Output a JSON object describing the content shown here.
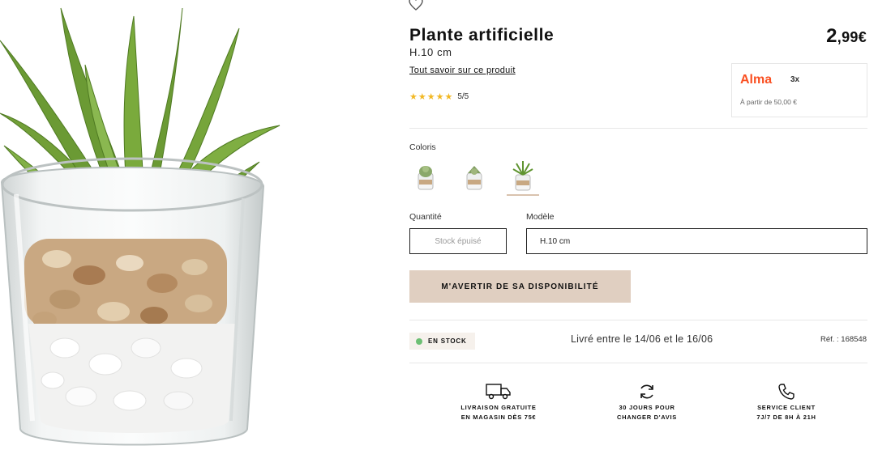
{
  "product": {
    "title": "Plante artificielle",
    "subtitle": "H.10 cm",
    "about_link": "Tout savoir sur ce produit",
    "rating_stars": "★★★★★",
    "rating_text": "5/5",
    "price_main": "2",
    "price_cents": ",99€"
  },
  "alma": {
    "logo": "Alma",
    "installments": "3x",
    "from": "À partir de 50,00 €"
  },
  "options": {
    "coloris_label": "Coloris",
    "coloris": [
      "Succulente ronde",
      "Succulente rosette",
      "Plante pointue"
    ],
    "coloris_selected_index": 2,
    "quantity_label": "Quantité",
    "quantity_placeholder": "Stock épuisé",
    "model_label": "Modèle",
    "model_value": "H.10 cm"
  },
  "actions": {
    "notify_label": "M'AVERTIR DE SA DISPONIBILITÉ"
  },
  "availability": {
    "stock_label": "EN STOCK",
    "delivery_text": "Livré entre le 14/06 et le 16/06",
    "reference": "Réf. : 168548"
  },
  "services": [
    {
      "icon": "truck-icon",
      "line1": "LIVRAISON GRATUITE",
      "line2": "EN MAGASIN DÈS 75€"
    },
    {
      "icon": "refresh-icon",
      "line1": "30 JOURS POUR",
      "line2": "CHANGER D'AVIS"
    },
    {
      "icon": "phone-icon",
      "line1": "SERVICE CLIENT",
      "line2": "7J/7 DE 8H À 21H"
    }
  ],
  "colors": {
    "accent_button": "#e0cfc1",
    "star": "#f2b824",
    "alma_brand": "#fa5022",
    "stock_dot": "#6dbf74"
  }
}
